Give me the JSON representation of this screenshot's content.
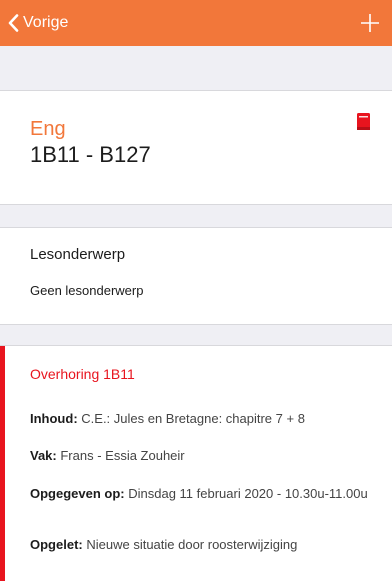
{
  "navbar": {
    "back_label": "Vorige",
    "add_label": "+"
  },
  "lesson": {
    "subject": "Eng",
    "class_room": "1B11  - B127",
    "topic_label": "Lesonderwerp",
    "topic_value": "Geen lesonderwerp"
  },
  "test": {
    "title": "Overhoring 1B11",
    "content_key": "Inhoud:",
    "content_value": " C.E.: Jules en Bretagne: chapitre 7 + 8",
    "subject_key": "Vak:",
    "subject_value": " Frans - Essia Zouheir",
    "given_key": "Opgegeven op:",
    "given_value": " Dinsdag 11 februari 2020 - 10.30u-11.00u",
    "note_key": "Opgelet:",
    "note_value": " Nieuwe situatie door roosterwijziging"
  },
  "icons": {
    "back": "chevron-left-icon",
    "add": "plus-icon",
    "book": "book-icon"
  },
  "colors": {
    "accent": "#f2773a",
    "test": "#e8141e",
    "separator": "#efeff4"
  }
}
